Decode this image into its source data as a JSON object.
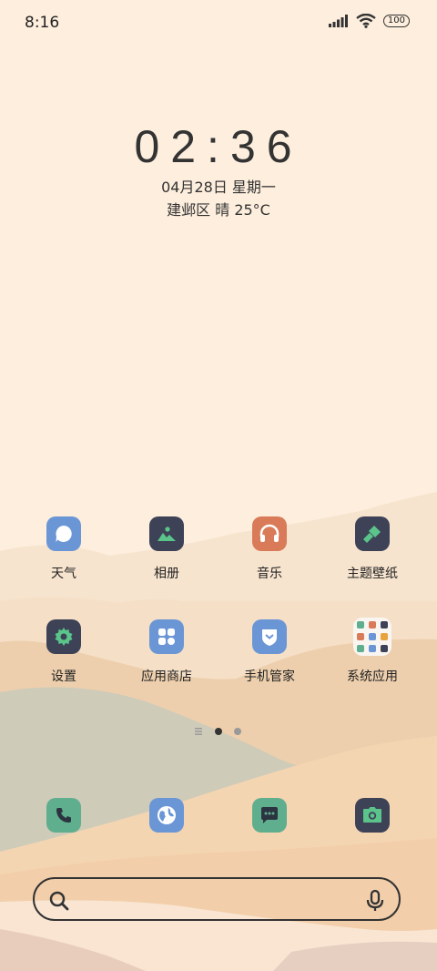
{
  "status_bar": {
    "time": "8:16",
    "battery": "100",
    "icons": [
      "signal-icon",
      "wifi-icon",
      "battery-icon"
    ]
  },
  "clock": {
    "time": "02:36",
    "date": "04月28日 星期一",
    "weather": "建邺区 晴 25°C"
  },
  "apps": [
    {
      "label": "天气",
      "icon": "weather-icon",
      "color": "#6b96d6"
    },
    {
      "label": "相册",
      "icon": "gallery-icon",
      "color": "#3d4257"
    },
    {
      "label": "音乐",
      "icon": "music-icon",
      "color": "#d97b58"
    },
    {
      "label": "主题壁纸",
      "icon": "theme-icon",
      "color": "#3d4257"
    },
    {
      "label": "设置",
      "icon": "settings-icon",
      "color": "#3d4257"
    },
    {
      "label": "应用商店",
      "icon": "app-store-icon",
      "color": "#6b96d6"
    },
    {
      "label": "手机管家",
      "icon": "phone-manager-icon",
      "color": "#6b96d6"
    },
    {
      "label": "系统应用",
      "icon": "folder-icon",
      "color": "#f9f6f2"
    }
  ],
  "dock": [
    {
      "icon": "phone-icon",
      "color": "#5fae8e"
    },
    {
      "icon": "browser-icon",
      "color": "#6b96d6"
    },
    {
      "icon": "messages-icon",
      "color": "#5fae8e"
    },
    {
      "icon": "camera-icon",
      "color": "#3d4257"
    }
  ],
  "search": {
    "icons": [
      "search-icon",
      "microphone-icon"
    ]
  },
  "colors": {
    "accent_green": "#5bc48a",
    "dark": "#3d4257",
    "blue": "#6b96d6",
    "orange": "#d97b58"
  }
}
